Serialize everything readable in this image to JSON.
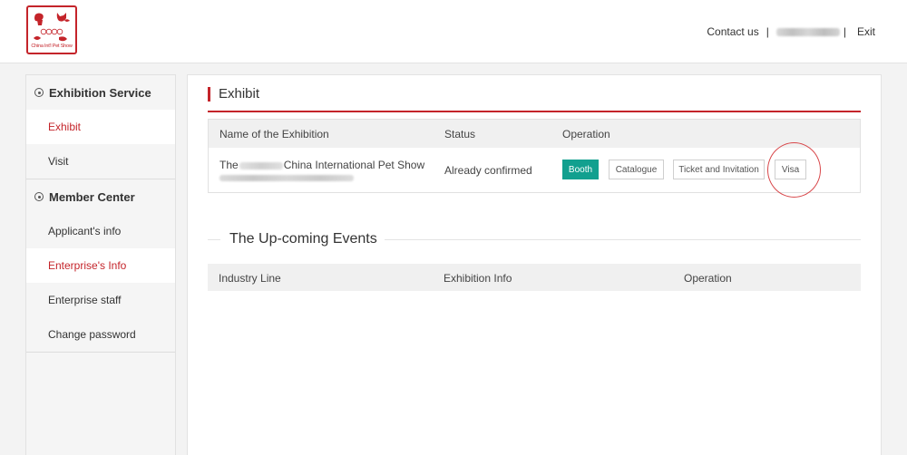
{
  "header": {
    "logo_text": "China Int'l Pet Show",
    "logo_initials": "CIPS",
    "contact_label": "Contact us",
    "separator": "|",
    "exit_label": "Exit"
  },
  "sidebar": {
    "sections": [
      {
        "title": "Exhibition Service",
        "items": [
          "Exhibit",
          "Visit"
        ]
      },
      {
        "title": "Member Center",
        "items": [
          "Applicant's info",
          "Enterprise's Info",
          "Enterprise staff",
          "Change password"
        ]
      }
    ],
    "active_items": [
      "Exhibit",
      "Enterprise's Info"
    ]
  },
  "main": {
    "title": "Exhibit",
    "table": {
      "headers": [
        "Name of the Exhibition",
        "Status",
        "Operation"
      ],
      "row": {
        "name_prefix": "The",
        "name_suffix": "China International Pet Show",
        "status": "Already confirmed",
        "buttons": [
          "Booth",
          "Catalogue",
          "Ticket and Invitation",
          "Visa"
        ]
      }
    },
    "upcoming": {
      "title": "The Up-coming Events",
      "headers": [
        "Industry Line",
        "Exhibition Info",
        "Operation"
      ]
    }
  },
  "colors": {
    "accent": "#c4242a",
    "primary_button": "#12a08f",
    "highlight_circle": "#d8474a"
  }
}
